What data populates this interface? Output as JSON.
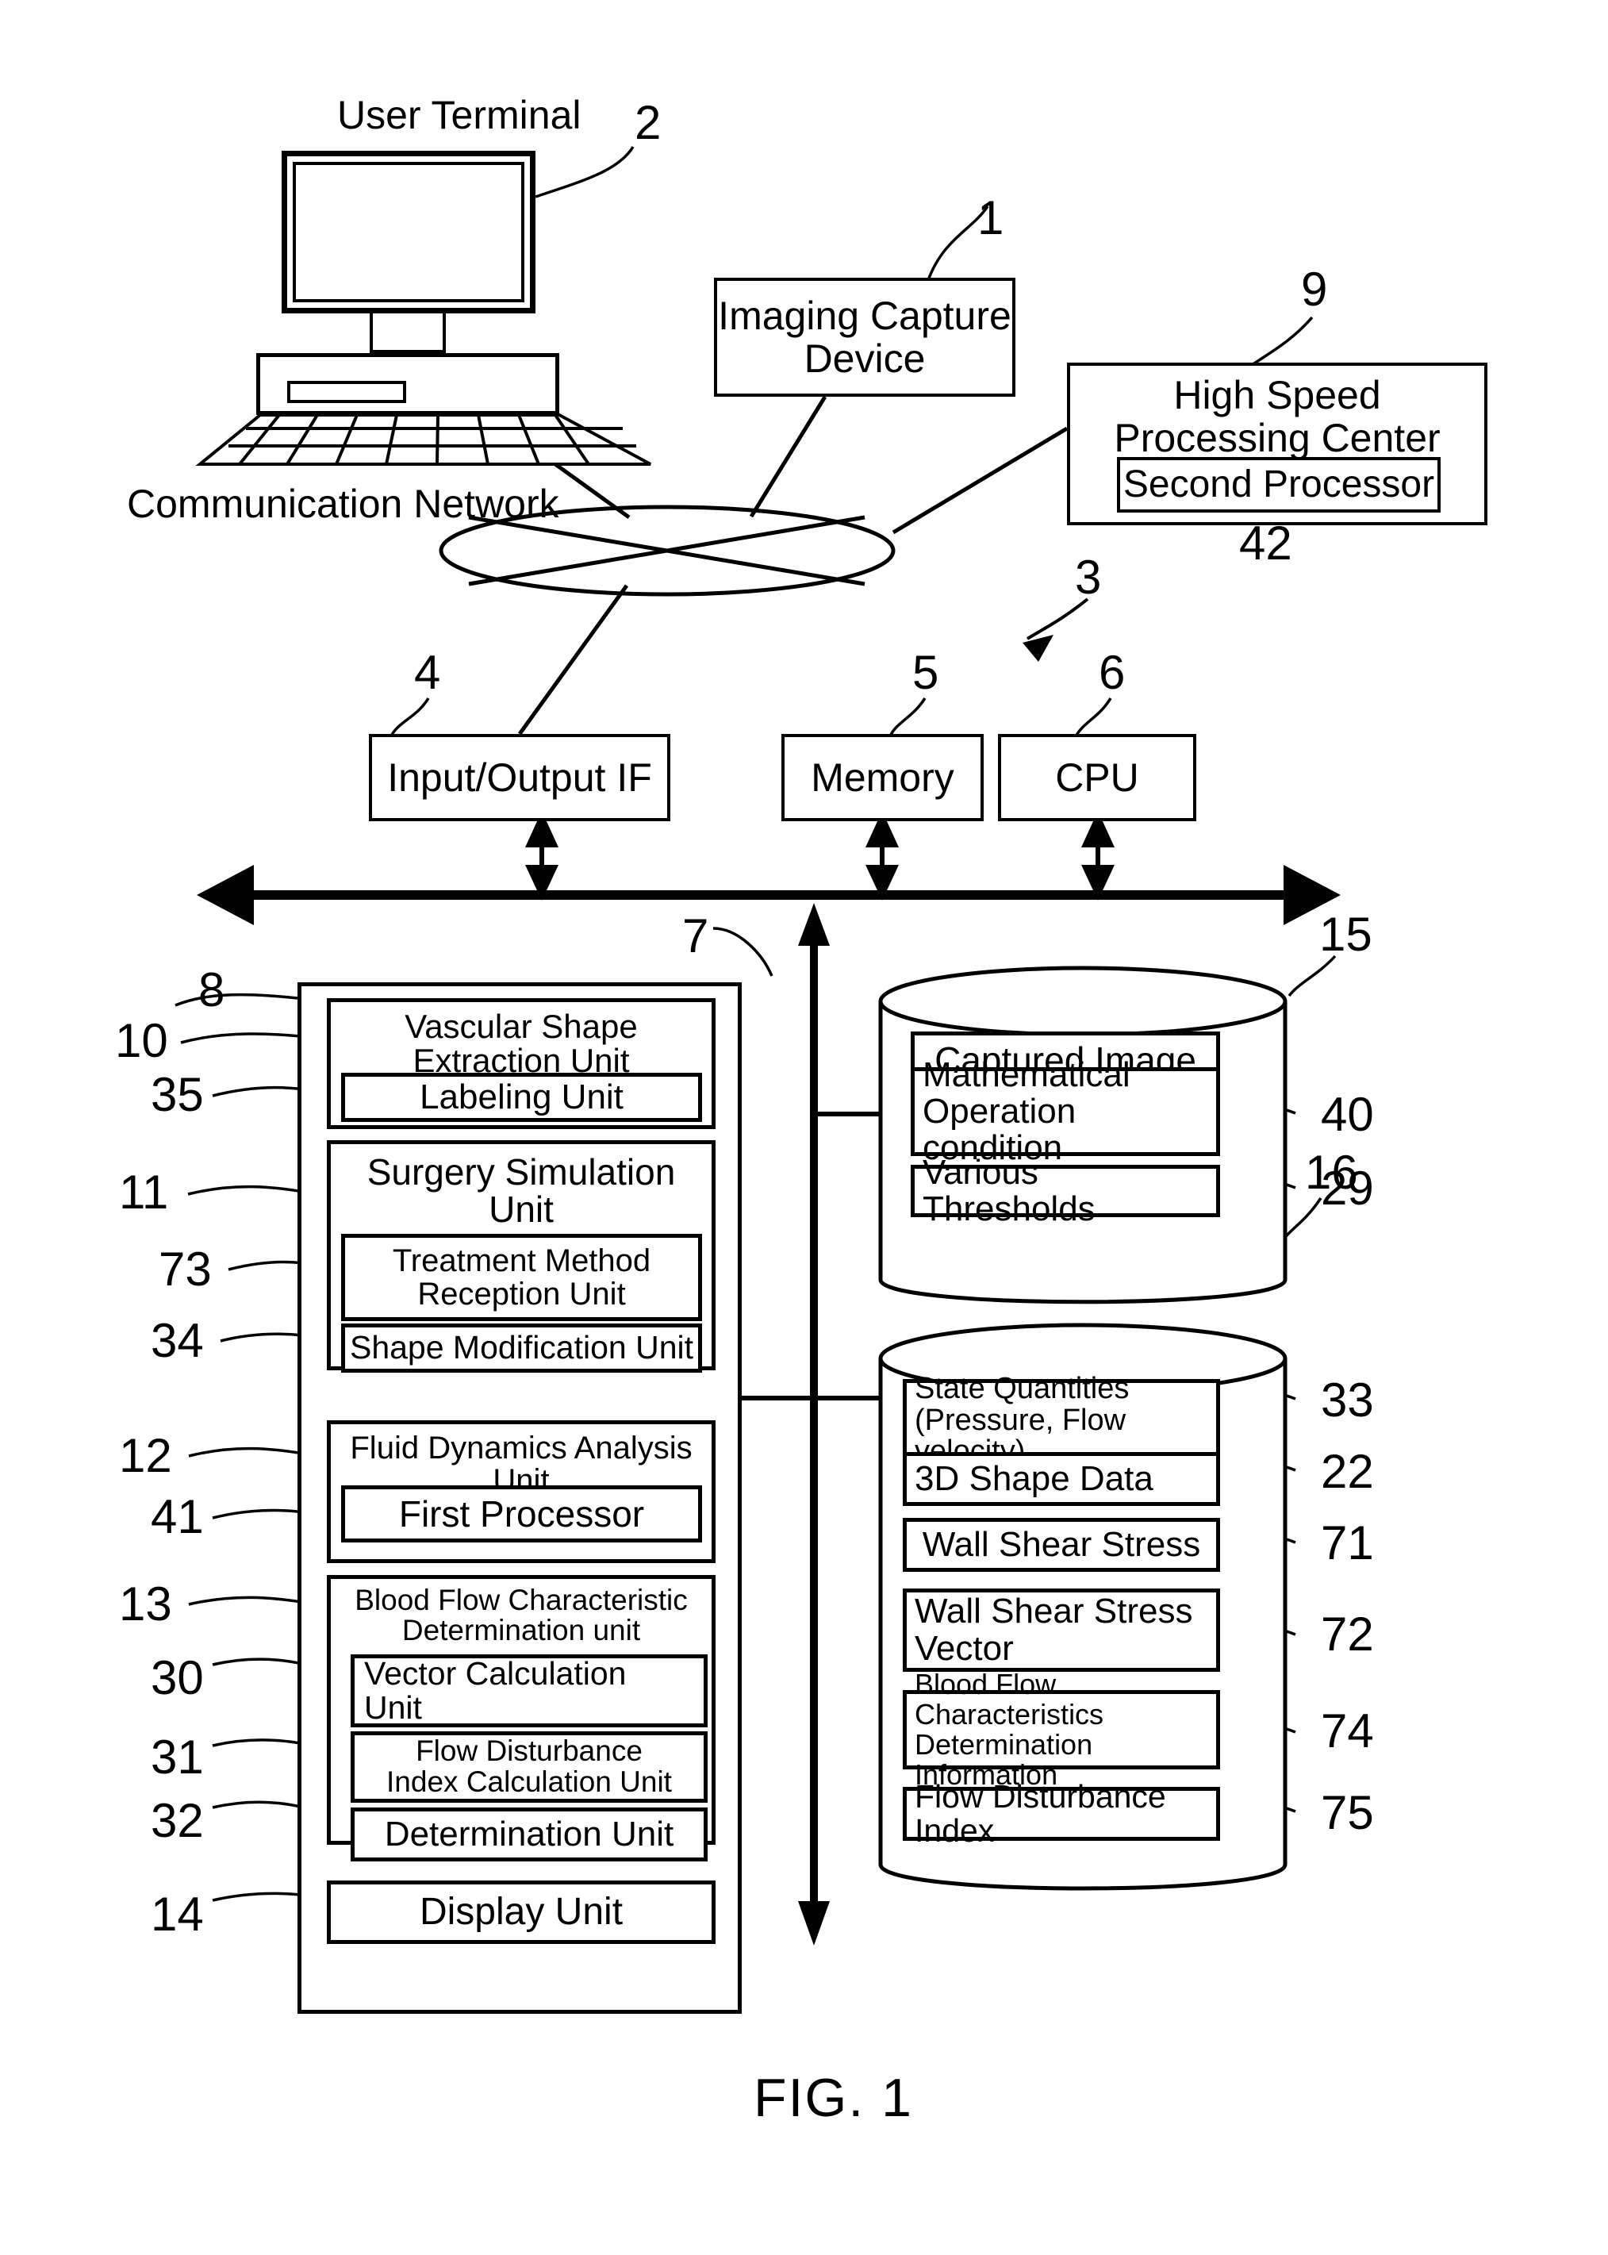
{
  "figure": {
    "caption": "FIG. 1"
  },
  "top": {
    "user_terminal_label": "User Terminal",
    "user_terminal_ref": "2",
    "imaging_capture_device": "Imaging Capture\nDevice",
    "imaging_capture_device_line1": "Imaging Capture",
    "imaging_capture_device_line2": "Device",
    "imaging_capture_device_ref": "1",
    "high_speed_center_line1": "High Speed",
    "high_speed_center_line2": "Processing Center",
    "high_speed_center_ref": "9",
    "second_processor": "Second Processor",
    "second_processor_ref": "42",
    "communication_network_label": "Communication Network",
    "system_ref": "3"
  },
  "bus_row": {
    "io_interface": "Input/Output IF",
    "io_interface_ref": "4",
    "memory": "Memory",
    "memory_ref": "5",
    "cpu": "CPU",
    "cpu_ref": "6",
    "bus_ref": "7"
  },
  "processing_panel": {
    "panel_ref": "8",
    "groups": [
      {
        "title_line1": "Vascular Shape",
        "title_line2": "Extraction Unit",
        "ref": "10",
        "children": [
          {
            "label": "Labeling Unit",
            "ref": "35"
          }
        ]
      },
      {
        "title_line1": "Surgery Simulation",
        "title_line2": "Unit",
        "ref": "11",
        "children": [
          {
            "label_line1": "Treatment Method",
            "label_line2": "Reception Unit",
            "ref": "73"
          },
          {
            "label": "Shape Modification Unit",
            "ref": "34"
          }
        ]
      },
      {
        "title_line1": "Fluid Dynamics Analysis Unit",
        "title_line2": "",
        "ref": "12",
        "children": [
          {
            "label": "First Processor",
            "ref": "41"
          }
        ]
      },
      {
        "title_line1": "Blood Flow Characteristic",
        "title_line2": "Determination unit",
        "ref": "13",
        "children": [
          {
            "label_line1": "Vector Calculation",
            "label_line2": "Unit",
            "ref": "30"
          },
          {
            "label_line1": "Flow Disturbance",
            "label_line2": "Index Calculation Unit",
            "ref": "31"
          },
          {
            "label": "Determination Unit",
            "ref": "32"
          }
        ]
      }
    ],
    "display_unit": {
      "label": "Display Unit",
      "ref": "14"
    }
  },
  "storage_top": {
    "ref": "15",
    "items": [
      {
        "label": "Captured Image",
        "ref": ""
      },
      {
        "label_line1": "Mathematical",
        "label_line2": "Operation condition",
        "ref": "40"
      },
      {
        "label": "Various Thresholds",
        "ref": "29"
      }
    ]
  },
  "storage_bottom": {
    "ref": "16",
    "items": [
      {
        "label_line1": "State Quantities",
        "label_line2": "(Pressure, Flow velocity)",
        "ref": "33"
      },
      {
        "label": "3D Shape Data",
        "ref": "22"
      },
      {
        "label": "Wall Shear Stress",
        "ref": "71"
      },
      {
        "label_line1": "Wall Shear Stress",
        "label_line2": "Vector",
        "ref": "72"
      },
      {
        "label_line1": "Blood Flow Characteristics",
        "label_line2": "Determination Information",
        "ref": "74"
      },
      {
        "label": "Flow Disturbance Index",
        "ref": "75"
      }
    ]
  },
  "colors": {
    "ink": "#000000",
    "paper": "#ffffff"
  }
}
